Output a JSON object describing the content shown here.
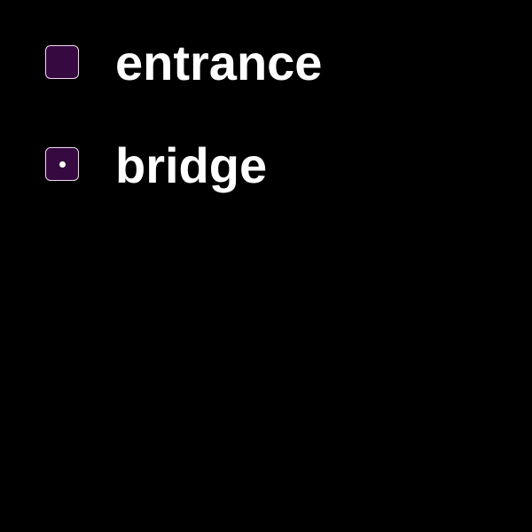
{
  "options": [
    {
      "label": "entrance",
      "selected": false
    },
    {
      "label": "bridge",
      "selected": true
    }
  ],
  "colors": {
    "box_fill": "#360a40",
    "box_border": "#f0d8f0",
    "text": "#ffffff",
    "background": "#000000"
  }
}
